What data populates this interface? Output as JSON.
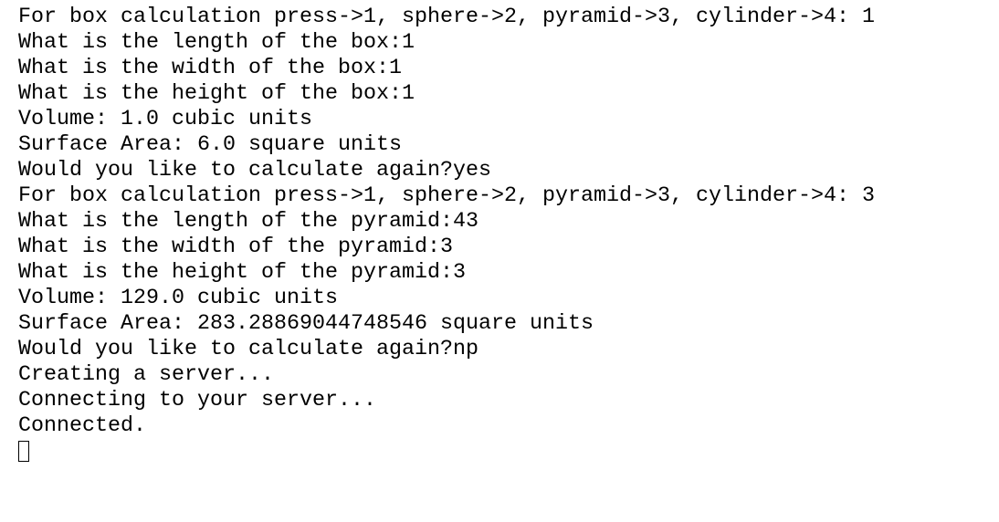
{
  "terminal": {
    "lines": [
      "For box calculation press->1, sphere->2, pyramid->3, cylinder->4: 1",
      "What is the length of the box:1",
      "What is the width of the box:1",
      "What is the height of the box:1",
      "Volume: 1.0 cubic units",
      "Surface Area: 6.0 square units",
      "Would you like to calculate again?yes",
      "For box calculation press->1, sphere->2, pyramid->3, cylinder->4: 3",
      "What is the length of the pyramid:43",
      "What is the width of the pyramid:3",
      "What is the height of the pyramid:3",
      "Volume: 129.0 cubic units",
      "Surface Area: 283.28869044748546 square units",
      "Would you like to calculate again?np",
      "Creating a server...",
      "Connecting to your server...",
      "Connected."
    ]
  },
  "colors": {
    "background": "#ffffff",
    "text": "#000000",
    "cursor_border": "#000000"
  }
}
